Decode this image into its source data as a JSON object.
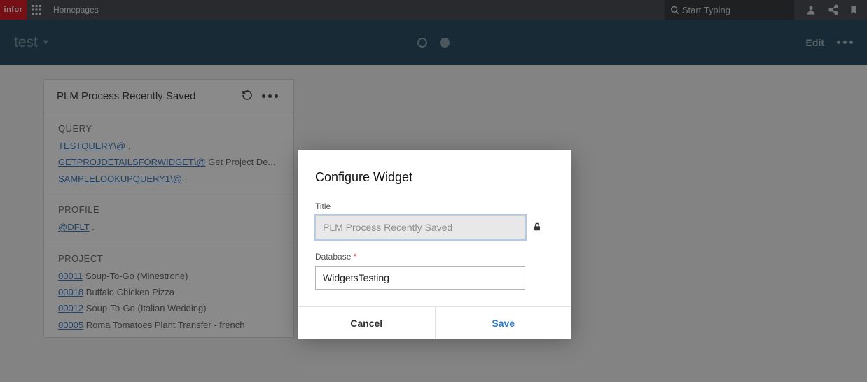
{
  "topbar": {
    "logo_text": "infor",
    "breadcrumb": "Homepages",
    "search_placeholder": "Start Typing"
  },
  "subheader": {
    "title": "test",
    "edit_label": "Edit"
  },
  "widget": {
    "title": "PLM Process Recently Saved",
    "sections": [
      {
        "heading": "QUERY",
        "rows": [
          {
            "link": "TESTQUERY\\@",
            "desc": "."
          },
          {
            "link": "GETPROJDETAILSFORWIDGET\\@",
            "desc": "Get Project De..."
          },
          {
            "link": "SAMPLELOOKUPQUERY1\\@",
            "desc": "."
          }
        ]
      },
      {
        "heading": "PROFILE",
        "rows": [
          {
            "link": "@DFLT",
            "desc": "."
          }
        ]
      },
      {
        "heading": "PROJECT",
        "rows": [
          {
            "link": "00011",
            "desc": "Soup-To-Go (Minestrone)"
          },
          {
            "link": "00018",
            "desc": "Buffalo Chicken Pizza"
          },
          {
            "link": "00012",
            "desc": "Soup-To-Go (Italian Wedding)"
          },
          {
            "link": "00005",
            "desc": "Roma Tomatoes Plant Transfer - french"
          }
        ]
      }
    ]
  },
  "modal": {
    "title": "Configure Widget",
    "title_field_label": "Title",
    "title_field_value": "PLM Process Recently Saved",
    "db_field_label": "Database",
    "db_field_value": "WidgetsTesting",
    "cancel_label": "Cancel",
    "save_label": "Save"
  }
}
